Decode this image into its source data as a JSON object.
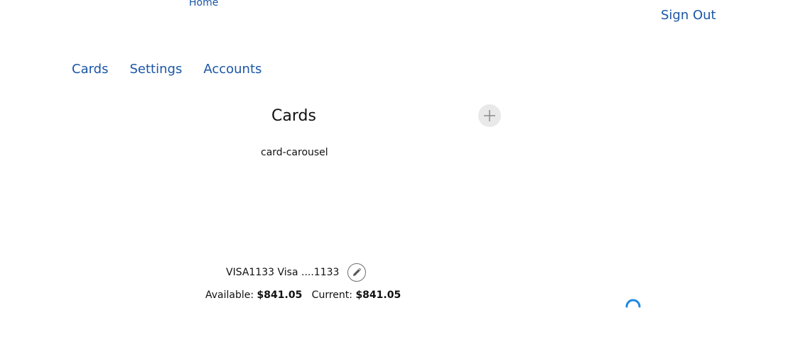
{
  "header": {
    "home_label": "Home",
    "sign_out_label": "Sign Out"
  },
  "nav": {
    "items": [
      {
        "label": "Cards"
      },
      {
        "label": "Settings"
      },
      {
        "label": "Accounts"
      }
    ]
  },
  "cards_section": {
    "title": "Cards",
    "carousel_label": "card-carousel",
    "add_icon": "plus-icon"
  },
  "card": {
    "name": "VISA1133 Visa ....1133",
    "edit_icon": "pencil-icon",
    "available_label": "Available:",
    "available_value": "$841.05",
    "current_label": "Current:",
    "current_value": "$841.05"
  },
  "colors": {
    "link": "#1a56a6",
    "spinner": "#1e88e5",
    "add_button_bg": "#e9e9e9"
  }
}
